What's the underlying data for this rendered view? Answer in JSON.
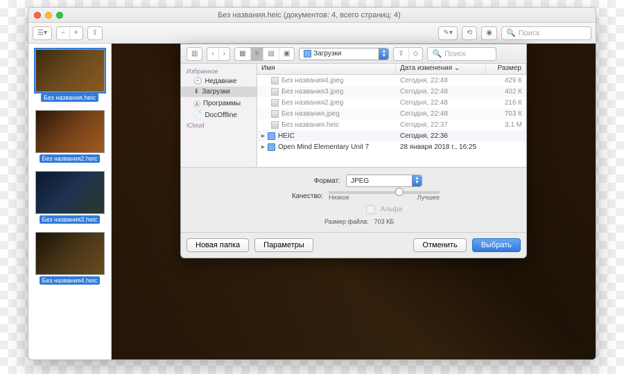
{
  "window": {
    "title": "Без названия.heic (документов: 4, всего страниц: 4)"
  },
  "toolbar": {
    "search_placeholder": "Поиск"
  },
  "thumbs": [
    {
      "label": "Без названия.heic",
      "bg": "linear-gradient(135deg,#3a2a0f,#6b4a1f,#8c5a1f)",
      "selected": true
    },
    {
      "label": "Без названия2.heic",
      "bg": "linear-gradient(135deg,#2a1508,#744018,#a35b1e)"
    },
    {
      "label": "Без названия3.heic",
      "bg": "linear-gradient(135deg,#0a1830,#1f3250,#2a3a2a)"
    },
    {
      "label": "Без названия4.heic",
      "bg": "linear-gradient(135deg,#1a1208,#4a3518,#6b4a1f)"
    }
  ],
  "panel": {
    "location_label": "Загрузки",
    "search_placeholder": "Поиск",
    "sidebar": {
      "fav_header": "Избранное",
      "items": [
        {
          "label": "Недавние",
          "selected": false
        },
        {
          "label": "Загрузки",
          "selected": true
        },
        {
          "label": "Программы",
          "selected": false
        },
        {
          "label": "DocOffline",
          "selected": false
        }
      ],
      "icloud_header": "iCloud"
    },
    "columns": {
      "name": "Имя",
      "date": "Дата изменения",
      "size": "Размер"
    },
    "rows": [
      {
        "kind": "img",
        "name": "Без названия4.jpeg",
        "date": "Сегодня, 22:48",
        "size": "429 К",
        "dim": true
      },
      {
        "kind": "img",
        "name": "Без названия3.jpeg",
        "date": "Сегодня, 22:48",
        "size": "402 К",
        "dim": true
      },
      {
        "kind": "img",
        "name": "Без названия2.jpeg",
        "date": "Сегодня, 22:48",
        "size": "216 К",
        "dim": true
      },
      {
        "kind": "img",
        "name": "Без названия.jpeg",
        "date": "Сегодня, 22:48",
        "size": "703 К",
        "dim": true
      },
      {
        "kind": "img",
        "name": "Без названия.heic",
        "date": "Сегодня, 22:37",
        "size": "3,1 М",
        "dim": true
      },
      {
        "kind": "fld",
        "name": "HEIC",
        "date": "Сегодня, 22:36",
        "size": "",
        "dim": false
      },
      {
        "kind": "fld",
        "name": "Open Mind Elementary Unit 7",
        "date": "28 января 2018 г., 16:25",
        "size": "",
        "dim": false
      }
    ],
    "format_label": "Формат:",
    "format_value": "JPEG",
    "quality_label": "Качество:",
    "quality_low": "Низкое",
    "quality_high": "Лучшее",
    "alpha_label": "Альфа",
    "filesize_label": "Размер файла:",
    "filesize_value": "703 КБ",
    "new_folder": "Новая папка",
    "options": "Параметры",
    "cancel": "Отменить",
    "save": "Выбрать"
  }
}
